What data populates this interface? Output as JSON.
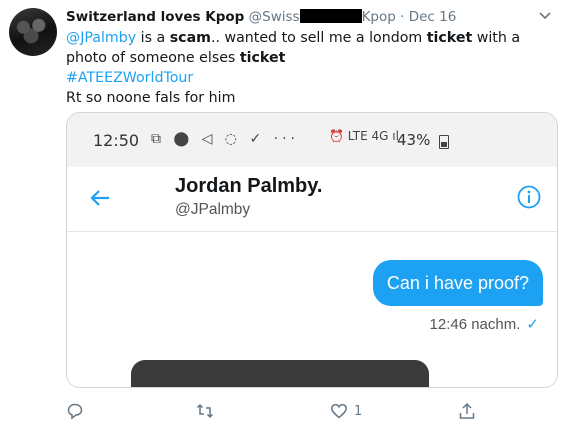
{
  "tweet": {
    "display_name": "Switzerland loves Kpop",
    "handle_start": "@Swiss",
    "handle_end": "Kpop",
    "separator": "·",
    "date": "Dec 16",
    "text": {
      "mention": "@JPalmby",
      "part1": " is a ",
      "scam": "scam",
      "part2": ".. wanted to sell me a londom ",
      "ticket1": "ticket",
      "part3": " with a photo of someone elses ",
      "ticket2": "ticket",
      "hashtag": "#ATEEZWorldTour",
      "line3": "Rt so noone fals for him"
    }
  },
  "screenshot": {
    "status_time": "12:50",
    "battery": "43%",
    "contact_name": "Jordan Palmby.",
    "contact_handle": "@JPalmby",
    "message": "Can i have proof?",
    "message_time": "12:46 nachm.",
    "read_mark": "✓"
  },
  "actions": {
    "retweets": "",
    "likes": "1"
  },
  "colors": {
    "accent": "#1da1f2",
    "muted": "#657786",
    "text": "#14171a"
  }
}
